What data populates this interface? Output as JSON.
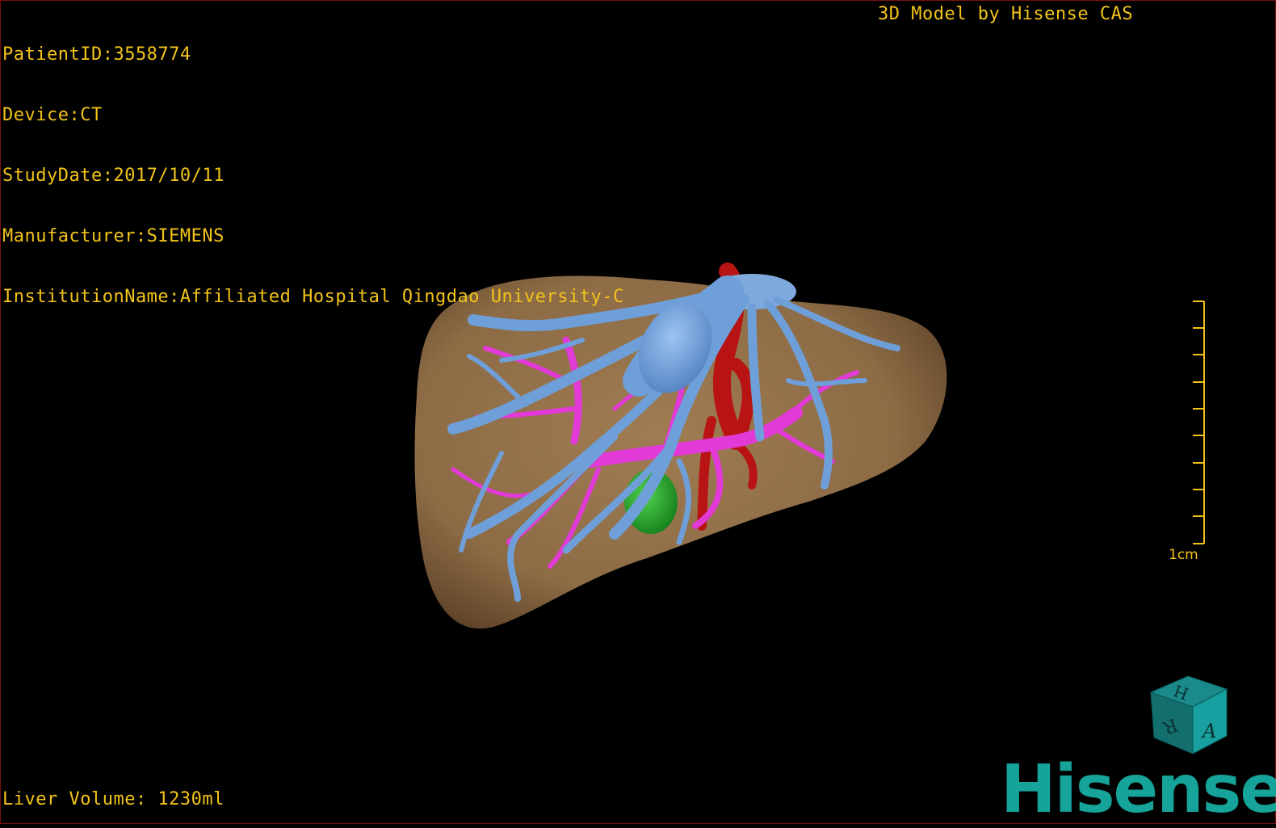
{
  "header": {
    "patient_id": "PatientID:3558774",
    "device": "Device:CT",
    "study_date": "StudyDate:2017/10/11",
    "manufacturer": "Manufacturer:SIEMENS",
    "institution": "InstitutionName:Affiliated Hospital Qingdao University-C",
    "brand_caption": "3D Model by Hisense CAS"
  },
  "footer": {
    "liver_volume": "Liver Volume: 1230ml"
  },
  "scale_bar": {
    "label": "1cm"
  },
  "logo": {
    "text": "Hisense"
  },
  "orientation_cube": {
    "faces": [
      "H",
      "R",
      "A"
    ]
  },
  "colors": {
    "liver": "#8c6b45",
    "portal_vein": "#6f9fd8",
    "hepatic_vessels": "#e23ad6",
    "artery": "#b81414",
    "gallbladder": "#22a22a",
    "overlay_text": "#f2c31a",
    "brand": "#15a39a"
  }
}
